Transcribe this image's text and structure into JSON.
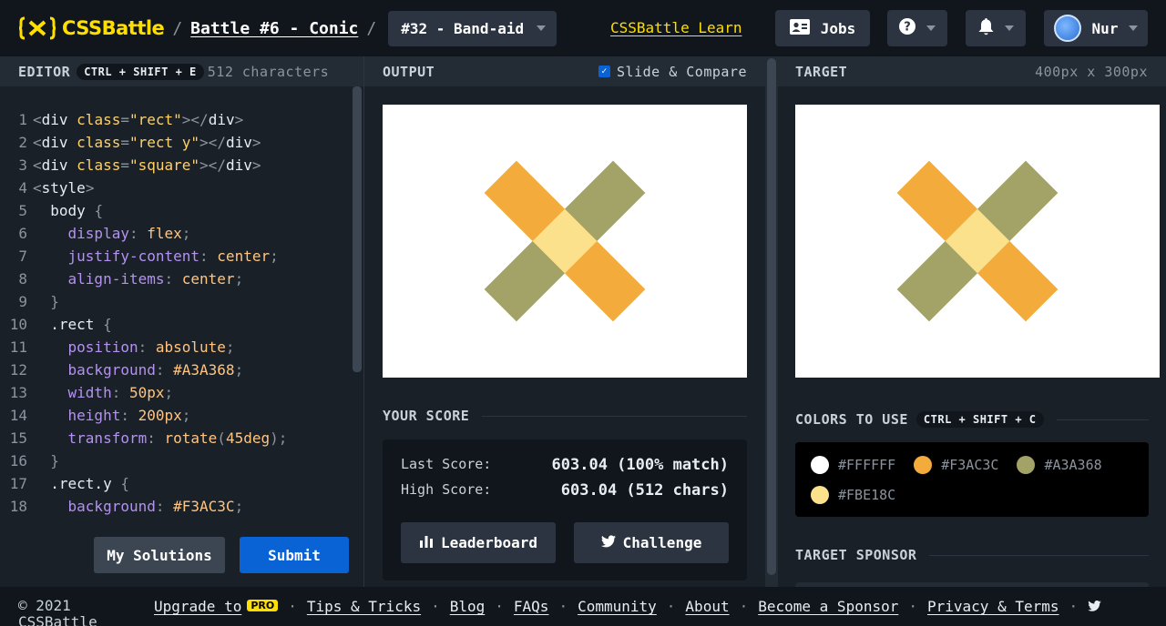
{
  "header": {
    "logo_text": "CSSBattle",
    "battle_link": "Battle #6 - Conic",
    "challenge_label": "#32 - Band-aid",
    "learn_link": "CSSBattle Learn",
    "jobs_label": "Jobs",
    "user_name": "Nur",
    "brand_color": "#FFDF00"
  },
  "editor": {
    "title": "EDITOR",
    "shortcut": "CTRL + SHIFT + E",
    "char_count": "512 characters",
    "my_solutions_label": "My Solutions",
    "submit_label": "Submit",
    "lines": [
      {
        "n": "1",
        "t": [
          [
            "tok-punc",
            "<"
          ],
          [
            "tok-tag",
            "div "
          ],
          [
            "tok-attr",
            "class"
          ],
          [
            "tok-punc",
            "="
          ],
          [
            "tok-str",
            "\"rect\""
          ],
          [
            "tok-punc",
            "></"
          ],
          [
            "tok-tag",
            "div"
          ],
          [
            "tok-punc",
            ">"
          ]
        ]
      },
      {
        "n": "2",
        "t": [
          [
            "tok-punc",
            "<"
          ],
          [
            "tok-tag",
            "div "
          ],
          [
            "tok-attr",
            "class"
          ],
          [
            "tok-punc",
            "="
          ],
          [
            "tok-str",
            "\"rect y\""
          ],
          [
            "tok-punc",
            "></"
          ],
          [
            "tok-tag",
            "div"
          ],
          [
            "tok-punc",
            ">"
          ]
        ]
      },
      {
        "n": "3",
        "t": [
          [
            "tok-punc",
            "<"
          ],
          [
            "tok-tag",
            "div "
          ],
          [
            "tok-attr",
            "class"
          ],
          [
            "tok-punc",
            "="
          ],
          [
            "tok-str",
            "\"square\""
          ],
          [
            "tok-punc",
            "></"
          ],
          [
            "tok-tag",
            "div"
          ],
          [
            "tok-punc",
            ">"
          ]
        ]
      },
      {
        "n": "4",
        "t": [
          [
            "tok-punc",
            "<"
          ],
          [
            "tok-tag",
            "style"
          ],
          [
            "tok-punc",
            ">"
          ]
        ]
      },
      {
        "n": "5",
        "t": [
          [
            "tok-sel",
            "  body "
          ],
          [
            "tok-punc",
            "{"
          ]
        ]
      },
      {
        "n": "6",
        "t": [
          [
            "tok-prop",
            "    display"
          ],
          [
            "tok-punc",
            ": "
          ],
          [
            "tok-val",
            "flex"
          ],
          [
            "tok-punc",
            ";"
          ]
        ]
      },
      {
        "n": "7",
        "t": [
          [
            "tok-prop",
            "    justify-content"
          ],
          [
            "tok-punc",
            ": "
          ],
          [
            "tok-val",
            "center"
          ],
          [
            "tok-punc",
            ";"
          ]
        ]
      },
      {
        "n": "8",
        "t": [
          [
            "tok-prop",
            "    align-items"
          ],
          [
            "tok-punc",
            ": "
          ],
          [
            "tok-val",
            "center"
          ],
          [
            "tok-punc",
            ";"
          ]
        ]
      },
      {
        "n": "9",
        "t": [
          [
            "tok-punc",
            "  }"
          ]
        ]
      },
      {
        "n": "10",
        "t": [
          [
            "tok-sel",
            "  .rect "
          ],
          [
            "tok-punc",
            "{"
          ]
        ]
      },
      {
        "n": "11",
        "t": [
          [
            "tok-prop",
            "    position"
          ],
          [
            "tok-punc",
            ": "
          ],
          [
            "tok-val",
            "absolute"
          ],
          [
            "tok-punc",
            ";"
          ]
        ]
      },
      {
        "n": "12",
        "t": [
          [
            "tok-prop",
            "    background"
          ],
          [
            "tok-punc",
            ": "
          ],
          [
            "tok-val",
            "#A3A368"
          ],
          [
            "tok-punc",
            ";"
          ]
        ]
      },
      {
        "n": "13",
        "t": [
          [
            "tok-prop",
            "    width"
          ],
          [
            "tok-punc",
            ": "
          ],
          [
            "tok-val",
            "50px"
          ],
          [
            "tok-punc",
            ";"
          ]
        ]
      },
      {
        "n": "14",
        "t": [
          [
            "tok-prop",
            "    height"
          ],
          [
            "tok-punc",
            ": "
          ],
          [
            "tok-val",
            "200px"
          ],
          [
            "tok-punc",
            ";"
          ]
        ]
      },
      {
        "n": "15",
        "t": [
          [
            "tok-prop",
            "    transform"
          ],
          [
            "tok-punc",
            ": "
          ],
          [
            "tok-val",
            "rotate"
          ],
          [
            "tok-punc",
            "("
          ],
          [
            "tok-val",
            "45deg"
          ],
          [
            "tok-punc",
            ");"
          ]
        ]
      },
      {
        "n": "16",
        "t": [
          [
            "tok-punc",
            "  }"
          ]
        ]
      },
      {
        "n": "17",
        "t": [
          [
            "tok-sel",
            "  .rect.y "
          ],
          [
            "tok-punc",
            "{"
          ]
        ]
      },
      {
        "n": "18",
        "t": [
          [
            "tok-prop",
            "    background"
          ],
          [
            "tok-punc",
            ": "
          ],
          [
            "tok-val",
            "#F3AC3C"
          ],
          [
            "tok-punc",
            ";"
          ]
        ]
      }
    ]
  },
  "output": {
    "title": "OUTPUT",
    "slide_compare_label": "Slide & Compare",
    "slide_compare_checked": true
  },
  "score": {
    "title": "YOUR SCORE",
    "last_label": "Last Score:",
    "last_value": "603.04 (100% match)",
    "high_label": "High Score:",
    "high_value": "603.04 (512 chars)",
    "leaderboard_label": "Leaderboard",
    "challenge_label": "Challenge"
  },
  "target": {
    "title": "TARGET",
    "dimensions": "400px x 300px",
    "colors_title": "COLORS TO USE",
    "colors_shortcut": "CTRL + SHIFT + C",
    "colors": [
      {
        "hex": "#FFFFFF"
      },
      {
        "hex": "#F3AC3C"
      },
      {
        "hex": "#A3A368"
      },
      {
        "hex": "#FBE18C"
      }
    ],
    "sponsor_title": "TARGET SPONSOR"
  },
  "footer": {
    "copyright": "© 2021 CSSBattle",
    "links": [
      "Upgrade to",
      "Tips & Tricks",
      "Blog",
      "FAQs",
      "Community",
      "About",
      "Become a Sponsor",
      "Privacy & Terms"
    ],
    "pro_badge": "PRO"
  }
}
